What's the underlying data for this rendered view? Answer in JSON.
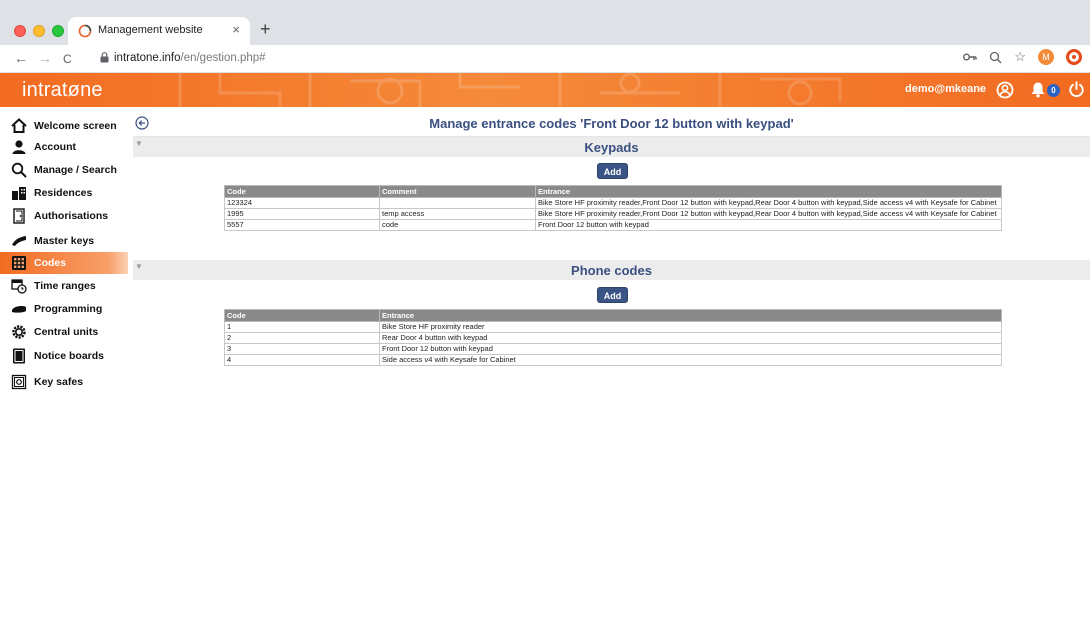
{
  "browser": {
    "tab_title": "Management website",
    "tab_close": "×",
    "new_tab": "+",
    "url_host": "intratone.info",
    "url_path": "/en/gestion.php#",
    "back": "←",
    "forward": "→",
    "reload": "C",
    "ext_m": "M"
  },
  "header": {
    "logo": "intratøne",
    "user": "demo@mkeane",
    "notifications_count": "0"
  },
  "sidebar": {
    "items": [
      {
        "label": "Welcome screen",
        "icon": "home-icon"
      },
      {
        "label": "Account",
        "icon": "user-icon"
      },
      {
        "label": "Manage / Search",
        "icon": "search-icon"
      },
      {
        "label": "Residences",
        "icon": "building-icon"
      },
      {
        "label": "Authorisations",
        "icon": "door-icon"
      },
      {
        "label": "Master keys",
        "icon": "key-icon"
      },
      {
        "label": "Codes",
        "icon": "keypad-icon",
        "active": true
      },
      {
        "label": "Time ranges",
        "icon": "calendar-clock-icon"
      },
      {
        "label": "Programming",
        "icon": "programmer-icon"
      },
      {
        "label": "Central units",
        "icon": "gear-icon"
      },
      {
        "label": "Notice boards",
        "icon": "board-icon"
      },
      {
        "label": "Key safes",
        "icon": "safe-icon"
      }
    ]
  },
  "main": {
    "title": "Manage entrance codes 'Front Door 12 button with keypad'",
    "keypads": {
      "title": "Keypads",
      "add_label": "Add",
      "columns": [
        "Code",
        "Comment",
        "Entrance"
      ],
      "rows": [
        [
          "123324",
          "",
          "Bike Store HF proximity reader,Front Door 12 button with keypad,Rear Door 4 button with keypad,Side access v4 with Keysafe for Cabinet"
        ],
        [
          "1995",
          "temp access",
          "Bike Store HF proximity reader,Front Door 12 button with keypad,Rear Door 4 button with keypad,Side access v4 with Keysafe for Cabinet"
        ],
        [
          "5557",
          "code",
          "Front Door 12 button with keypad"
        ]
      ]
    },
    "phone_codes": {
      "title": "Phone codes",
      "add_label": "Add",
      "columns": [
        "Code",
        "Entrance"
      ],
      "rows": [
        [
          "1",
          "Bike Store HF proximity reader"
        ],
        [
          "2",
          "Rear Door 4 button with keypad"
        ],
        [
          "3",
          "Front Door 12 button with keypad"
        ],
        [
          "4",
          "Side access v4 with Keysafe for Cabinet"
        ]
      ]
    }
  },
  "colors": {
    "brand_orange": "#f26b21",
    "title_blue": "#3a5080",
    "button_blue": "#3a5585"
  }
}
